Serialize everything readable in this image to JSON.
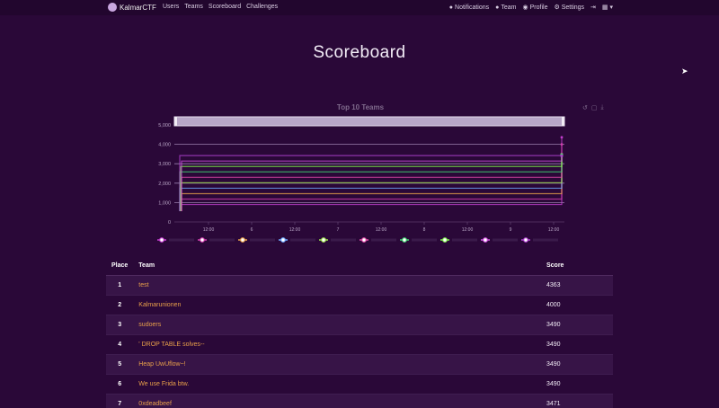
{
  "navbar": {
    "brand": "KalmarCTF",
    "links": [
      "Users",
      "Teams",
      "Scoreboard",
      "Challenges"
    ],
    "notifications": "Notifications",
    "team": "Team",
    "profile": "Profile",
    "settings": "Settings"
  },
  "page_title": "Scoreboard",
  "chart_data": {
    "type": "line",
    "title": "Top 10 Teams",
    "y_ticks": [
      "5,000",
      "4,000",
      "3,000",
      "2,000",
      "1,000",
      "0"
    ],
    "ylim": [
      0,
      5000
    ],
    "x_ticks": [
      "12:00",
      "6",
      "12:00",
      "7",
      "12:00",
      "8",
      "12:00",
      "9",
      "12:00"
    ],
    "grid": true,
    "legend_position": "bottom",
    "series": [
      {
        "color": "#c43fd0",
        "final_value": 4363
      },
      {
        "color": "#d03fae",
        "final_value": 4000
      },
      {
        "color": "#e8a04a",
        "final_value": 3490
      },
      {
        "color": "#6ea8ff",
        "final_value": 3490
      },
      {
        "color": "#9be04a",
        "final_value": 3490
      },
      {
        "color": "#e04aa8",
        "final_value": 3490
      },
      {
        "color": "#3fd06e",
        "final_value": 3471
      },
      {
        "color": "#7cf04a",
        "final_value": 3400
      },
      {
        "color": "#d050e0",
        "final_value": 3400
      },
      {
        "color": "#b040d0",
        "final_value": 3400
      }
    ]
  },
  "table": {
    "headers": {
      "place": "Place",
      "team": "Team",
      "score": "Score"
    },
    "rows": [
      {
        "place": "1",
        "team": "test",
        "score": "4363"
      },
      {
        "place": "2",
        "team": "Kalmarunionen",
        "score": "4000"
      },
      {
        "place": "3",
        "team": "sudoers",
        "score": "3490"
      },
      {
        "place": "4",
        "team": "' DROP TABLE solves--",
        "score": "3490"
      },
      {
        "place": "5",
        "team": "Heap UwUflow~!",
        "score": "3490"
      },
      {
        "place": "6",
        "team": "We use Frida btw.",
        "score": "3490"
      },
      {
        "place": "7",
        "team": "0xdeadbeef",
        "score": "3471"
      }
    ]
  }
}
